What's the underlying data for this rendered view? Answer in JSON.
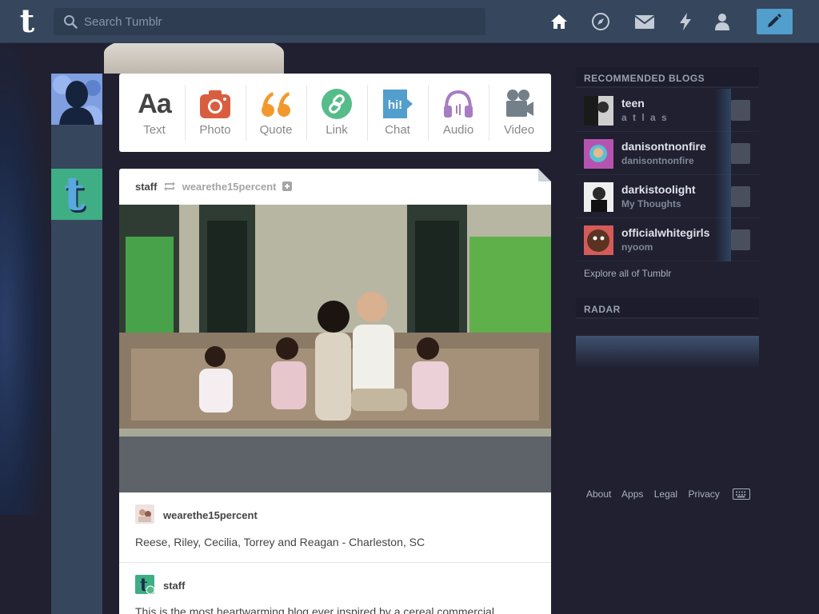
{
  "header": {
    "logo": "t",
    "search_placeholder": "Search Tumblr",
    "nav": [
      "home-icon",
      "explore-icon",
      "inbox-icon",
      "activity-icon",
      "account-icon"
    ],
    "compose_icon": "pencil-icon",
    "accent": "#529ecc"
  },
  "post_types": [
    {
      "label": "Text",
      "icon": "text-icon",
      "color": "#444444"
    },
    {
      "label": "Photo",
      "icon": "camera-icon",
      "color": "#d95e40"
    },
    {
      "label": "Quote",
      "icon": "quote-icon",
      "color": "#f2992e"
    },
    {
      "label": "Link",
      "icon": "link-icon",
      "color": "#56bc8a"
    },
    {
      "label": "Chat",
      "icon": "chat-icon",
      "color": "#529ecc"
    },
    {
      "label": "Audio",
      "icon": "headphones-icon",
      "color": "#a77dc2"
    },
    {
      "label": "Video",
      "icon": "video-camera-icon",
      "color": "#748089"
    }
  ],
  "post": {
    "author": "staff",
    "reblogged_from": "wearethe15percent",
    "reblog_name": "wearethe15percent",
    "caption": "Reese, Riley, Cecilia, Torrey and Reagan - Charleston, SC",
    "second_author": "staff",
    "second_body": "This is the most heartwarming blog ever inspired by a cereal commercial"
  },
  "sidebar": {
    "recommended_title": "RECOMMENDED BLOGS",
    "blogs": [
      {
        "name": "teen",
        "subtitle": "a t l a s"
      },
      {
        "name": "danisontnonfire",
        "subtitle": "danisontnonfire"
      },
      {
        "name": "darkistoolight",
        "subtitle": "My Thoughts"
      },
      {
        "name": "officialwhitegirls",
        "subtitle": "nyoom"
      }
    ],
    "explore": "Explore all of Tumblr",
    "radar_title": "RADAR"
  },
  "footer": {
    "links": [
      "About",
      "Apps",
      "Legal",
      "Privacy"
    ],
    "keyboard_icon": "keyboard-icon"
  }
}
